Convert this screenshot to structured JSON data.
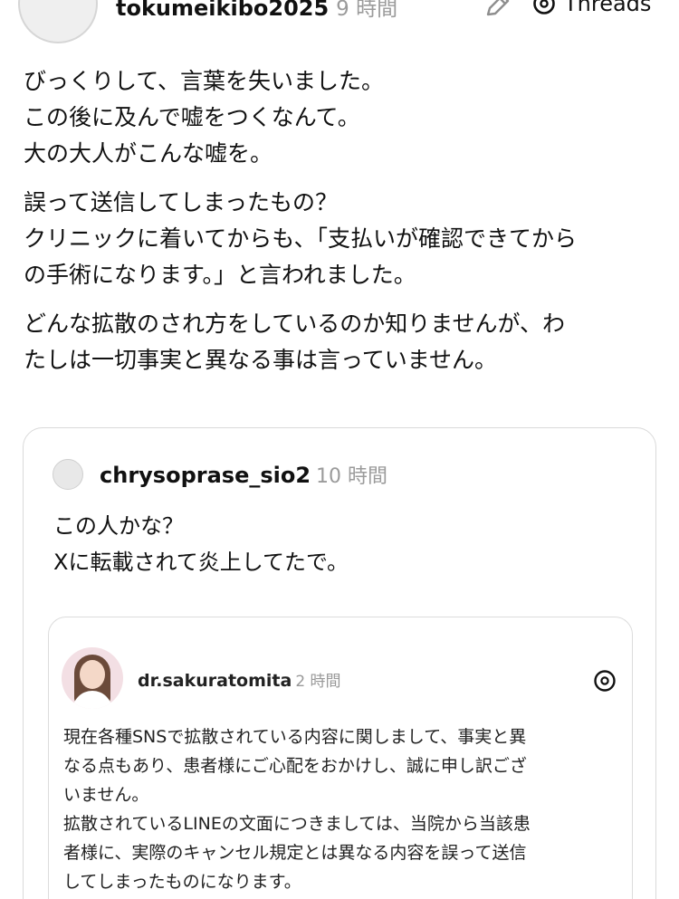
{
  "header": {
    "username": "tokumeikibo2025",
    "time": "9 時間",
    "threads_label": "Threads"
  },
  "post": {
    "paragraphs": [
      [
        "びっくりして、言葉を失いました。",
        "この後に及んで嘘をつくなんて。",
        "大の大人がこんな嘘を。"
      ],
      [
        "誤って送信してしまったもの？",
        "クリニックに着いてからも、「支払いが確認できてから",
        "の手術になります。」と言われました。"
      ],
      [
        "どんな拡散のされ方をしているのか知りませんが、わ",
        "たしは一切事実と異なる事は言っていません。"
      ]
    ]
  },
  "quote": {
    "username": "chrysoprase_sio2",
    "time": "10 時間",
    "lines": [
      "この人かな？",
      "Xに転載されて炎上してたで。"
    ]
  },
  "inner": {
    "username": "dr.sakuratomita",
    "time": "2 時間",
    "lines": [
      "現在各種SNSで拡散されている内容に関しまして、事実と異",
      "なる点もあり、患者様にご心配をおかけし、誠に申し訳ござ",
      "いません。",
      "拡散されているLINEの文面につきましては、当院から当該患",
      "者様に、実際のキャンセル規定とは異なる内容を誤って送信",
      "してしまったものになります。"
    ]
  }
}
